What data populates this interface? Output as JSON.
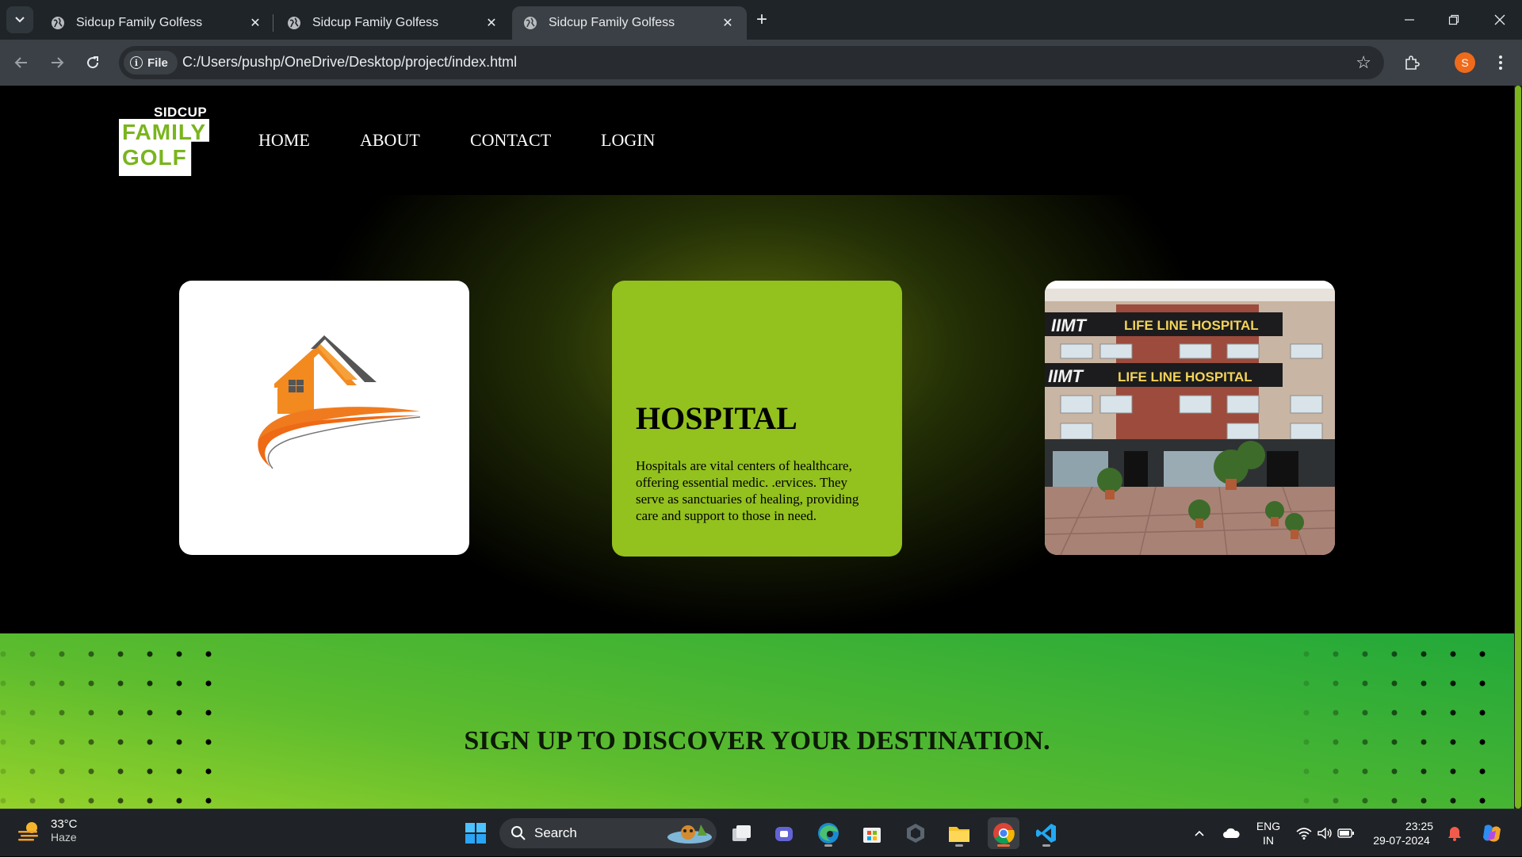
{
  "browser": {
    "tabs": [
      {
        "title": "Sidcup Family Golfess",
        "active": false
      },
      {
        "title": "Sidcup Family Golfess",
        "active": false
      },
      {
        "title": "Sidcup Family Golfess",
        "active": true
      }
    ],
    "file_chip": "File",
    "url": "C:/Users/pushp/OneDrive/Desktop/project/index.html",
    "profile_initial": "S"
  },
  "site": {
    "logo": {
      "top": "SIDCUP",
      "line1": "FAMILY",
      "line2": "GOLF"
    },
    "nav": [
      "HOME",
      "ABOUT",
      "CONTACT",
      "LOGIN"
    ],
    "card": {
      "heading": "HOSPITAL",
      "body": "Hospitals are vital centers of healthcare, offering essential medic.   .ervices. They serve as sanctuaries of healing, providing care and support to those in need."
    },
    "photo_signs": [
      "IIMT",
      "LIFE LINE HOSPITAL",
      "IIMT",
      "LIFE LINE HOSPITAL"
    ],
    "signup_title": "SIGN UP TO DISCOVER YOUR DESTINATION.",
    "accent": "#93c11e"
  },
  "taskbar": {
    "weather_temp": "33°C",
    "weather_desc": "Haze",
    "search_label": "Search",
    "lang_top": "ENG",
    "lang_bottom": "IN",
    "time": "23:25",
    "date": "29-07-2024"
  }
}
